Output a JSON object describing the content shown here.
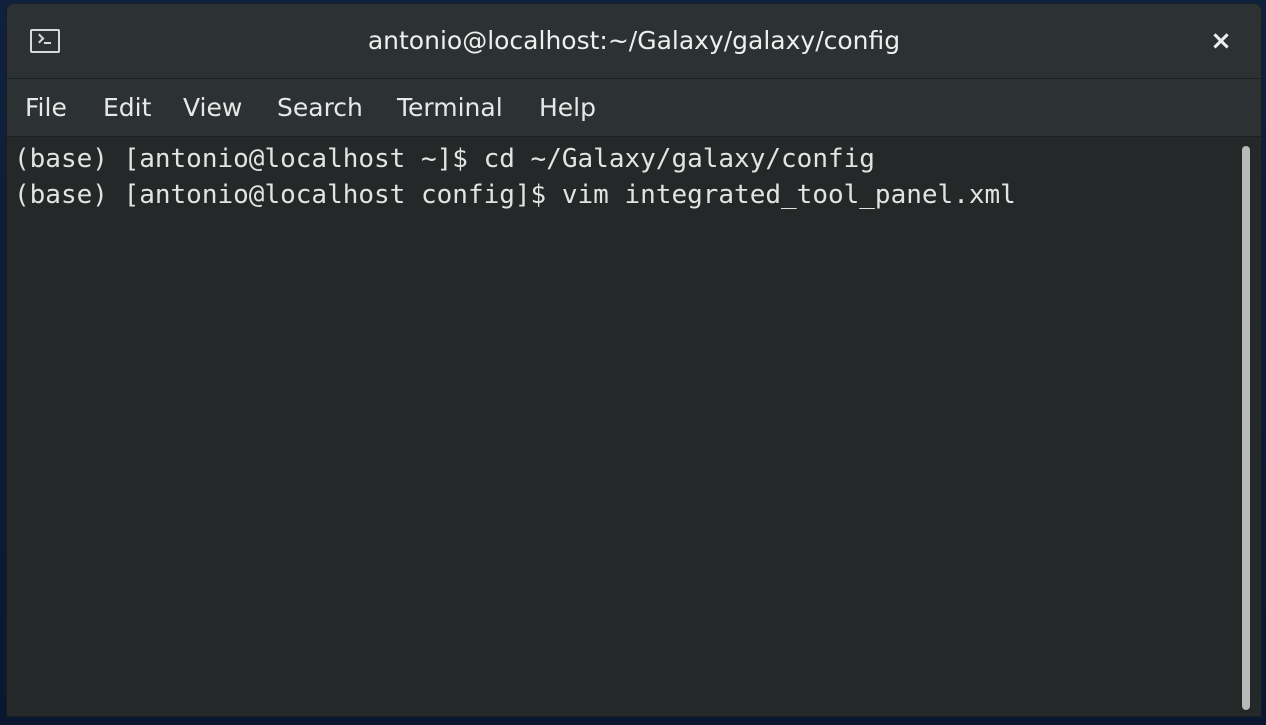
{
  "window": {
    "title": "antonio@localhost:~/Galaxy/galaxy/config",
    "icon": "terminal-icon",
    "close_glyph": "×"
  },
  "menu": [
    {
      "label": "File"
    },
    {
      "label": "Edit"
    },
    {
      "label": "View"
    },
    {
      "label": "Search"
    },
    {
      "label": "Terminal"
    },
    {
      "label": "Help"
    }
  ],
  "terminal": {
    "lines": [
      "(base) [antonio@localhost ~]$ cd ~/Galaxy/galaxy/config",
      "(base) [antonio@localhost config]$ vim integrated_tool_panel.xml"
    ]
  },
  "colors": {
    "titlebar": "#2c3133",
    "background": "#242829",
    "foreground": "#e3e3e1",
    "scrollbar": "#b8bab9"
  }
}
